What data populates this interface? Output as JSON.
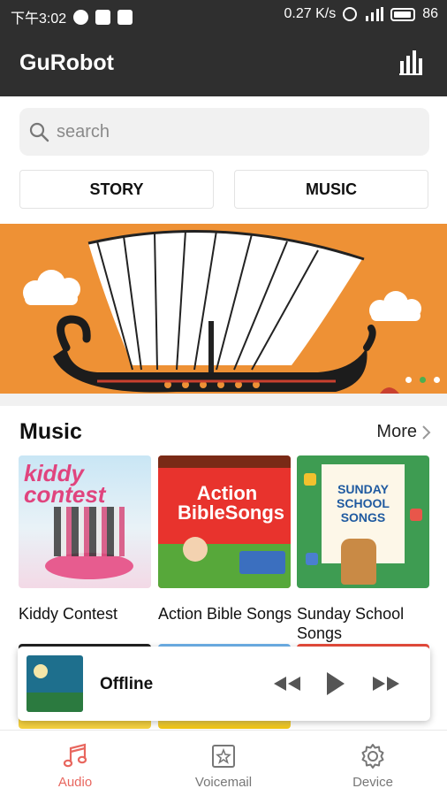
{
  "status_bar": {
    "time": "下午3:02",
    "network_speed": "0.27 K/s",
    "battery": "86"
  },
  "app": {
    "title": "GuRobot",
    "stats_icon": "bar-chart-icon"
  },
  "search": {
    "placeholder": "search"
  },
  "categories": [
    {
      "label": "STORY"
    },
    {
      "label": "MUSIC"
    }
  ],
  "banner": {
    "slide_count": 3,
    "active_slide": 2
  },
  "music_section": {
    "title": "Music",
    "more_label": "More",
    "albums": [
      {
        "title": "Kiddy Contest",
        "cover_text": "kiddy contest"
      },
      {
        "title": "Action Bible Songs",
        "cover_text": "Action BibleSongs"
      },
      {
        "title": "Sunday School Songs",
        "cover_text": "SUNDAY SCHOOL SONGS"
      }
    ]
  },
  "player": {
    "status": "Offline"
  },
  "bottom_nav": [
    {
      "label": "Audio",
      "icon": "music-note-icon",
      "active": true
    },
    {
      "label": "Voicemail",
      "icon": "star-box-icon",
      "active": false
    },
    {
      "label": "Device",
      "icon": "gear-icon",
      "active": false
    }
  ],
  "colors": {
    "topbar": "#2f2f2f",
    "banner": "#ee9135",
    "active_nav": "#e8675f",
    "active_dot": "#4caf50"
  }
}
